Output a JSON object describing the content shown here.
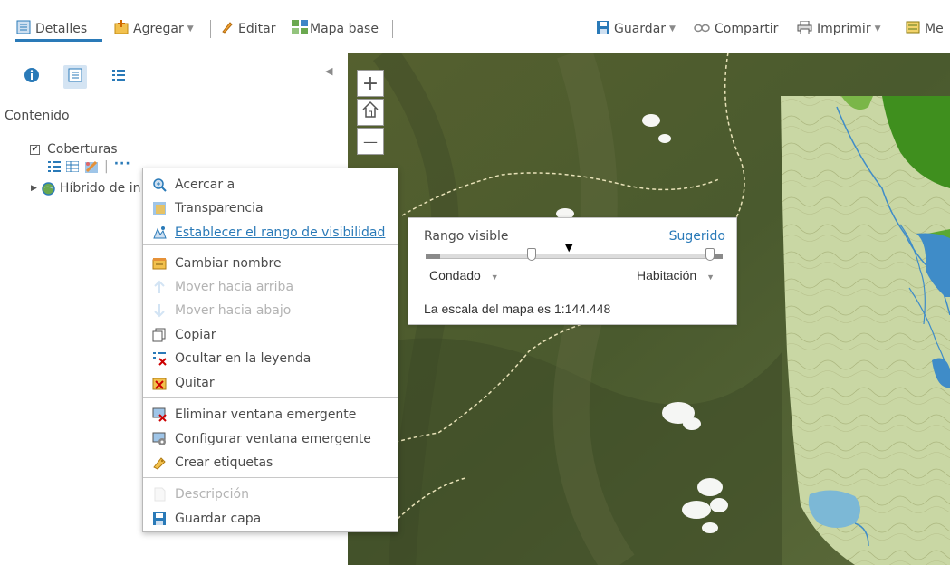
{
  "toolbar": {
    "details": "Detalles",
    "add": "Agregar",
    "edit": "Editar",
    "basemap": "Mapa base",
    "save": "Guardar",
    "share": "Compartir",
    "print": "Imprimir",
    "measure": "Me"
  },
  "panel": {
    "heading": "Contenido",
    "layers": [
      {
        "name": "Coberturas",
        "checked": true
      },
      {
        "name": "Híbrido de in",
        "checked": false
      }
    ]
  },
  "map": {
    "zoom_in": "+",
    "zoom_out": "—"
  },
  "context_menu": {
    "items": [
      {
        "label": "Acercar a",
        "icon": "zoom-to-icon",
        "disabled": false
      },
      {
        "label": "Transparencia",
        "icon": "transparency-icon",
        "disabled": false
      },
      {
        "label": "Establecer el rango de visibilidad",
        "icon": "visibility-range-icon",
        "disabled": false,
        "active": true
      },
      {
        "label": "Cambiar nombre",
        "icon": "rename-icon",
        "disabled": false
      },
      {
        "label": "Mover hacia arriba",
        "icon": "move-up-icon",
        "disabled": true
      },
      {
        "label": "Mover hacia abajo",
        "icon": "move-down-icon",
        "disabled": true
      },
      {
        "label": "Copiar",
        "icon": "copy-icon",
        "disabled": false
      },
      {
        "label": "Ocultar en la leyenda",
        "icon": "hide-legend-icon",
        "disabled": false
      },
      {
        "label": "Quitar",
        "icon": "remove-icon",
        "disabled": false
      },
      {
        "label": "Eliminar ventana emergente",
        "icon": "remove-popup-icon",
        "disabled": false
      },
      {
        "label": "Configurar ventana emergente",
        "icon": "configure-popup-icon",
        "disabled": false
      },
      {
        "label": "Crear etiquetas",
        "icon": "labels-icon",
        "disabled": false
      },
      {
        "label": "Descripción",
        "icon": "description-icon",
        "disabled": true
      },
      {
        "label": "Guardar capa",
        "icon": "save-layer-icon",
        "disabled": false
      }
    ]
  },
  "visible_range": {
    "title": "Rango visible",
    "suggested": "Sugerido",
    "min_label": "Condado",
    "max_label": "Habitación",
    "scale_text": "La escala del mapa es 1:144.448"
  },
  "colors": {
    "accent": "#2a7ab8",
    "toolbar_active": "#2a7ab8",
    "disabled_text": "#b3b3b3",
    "topo_overlay": "#c9d7a4",
    "forest": "#3f8f1e",
    "water": "#3f8cc8"
  }
}
